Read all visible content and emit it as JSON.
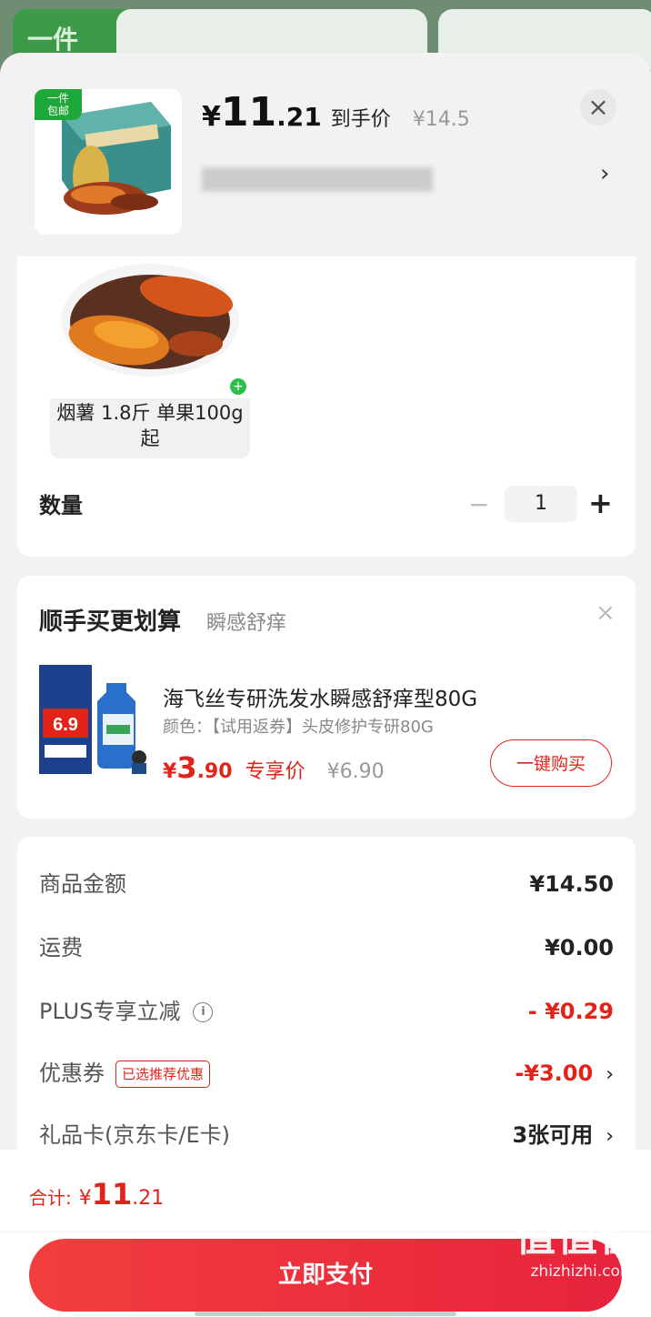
{
  "background": {
    "tab_label": "一件"
  },
  "header": {
    "badge": "一件\n包邮",
    "price_yen": "¥",
    "price_int": "11",
    "price_dec": ".21",
    "price_label": "到手价",
    "original_price": "¥14.5",
    "close_icon": "×",
    "chevron": "›"
  },
  "sku": {
    "label": "烟薯 1.8斤 单果100g起"
  },
  "quantity": {
    "label": "数量",
    "minus": "−",
    "value": "1",
    "plus": "+"
  },
  "upsell": {
    "title": "顺手买更划算",
    "subtitle": "瞬感舒痒",
    "close": "×",
    "product_name": "海飞丝专研洗发水瞬感舒痒型80G",
    "spec": "颜色：【试用返券】头皮修护专研80G",
    "price_yen": "¥",
    "price_int": "3",
    "price_dec": ".90",
    "price_tag": "专享价",
    "original_price": "¥6.90",
    "buy_button": "一键购买"
  },
  "summary": {
    "rows": [
      {
        "label": "商品金额",
        "value": "¥14.50"
      },
      {
        "label": "运费",
        "value": "¥0.00"
      },
      {
        "label": "PLUS专享立减",
        "value": "- ¥0.29"
      },
      {
        "label": "优惠券",
        "tag": "已选推荐优惠",
        "value": "-¥3.00"
      },
      {
        "label": "礼品卡(京东卡/E卡)",
        "value": "3张可用"
      }
    ]
  },
  "footer": {
    "total_label": "合计:",
    "total_yen": "¥",
    "total_int": "11",
    "total_dec": ".21",
    "pay_button": "立即支付"
  },
  "watermark": {
    "text": "值值值",
    "sub": "zhizhizhi.com"
  }
}
